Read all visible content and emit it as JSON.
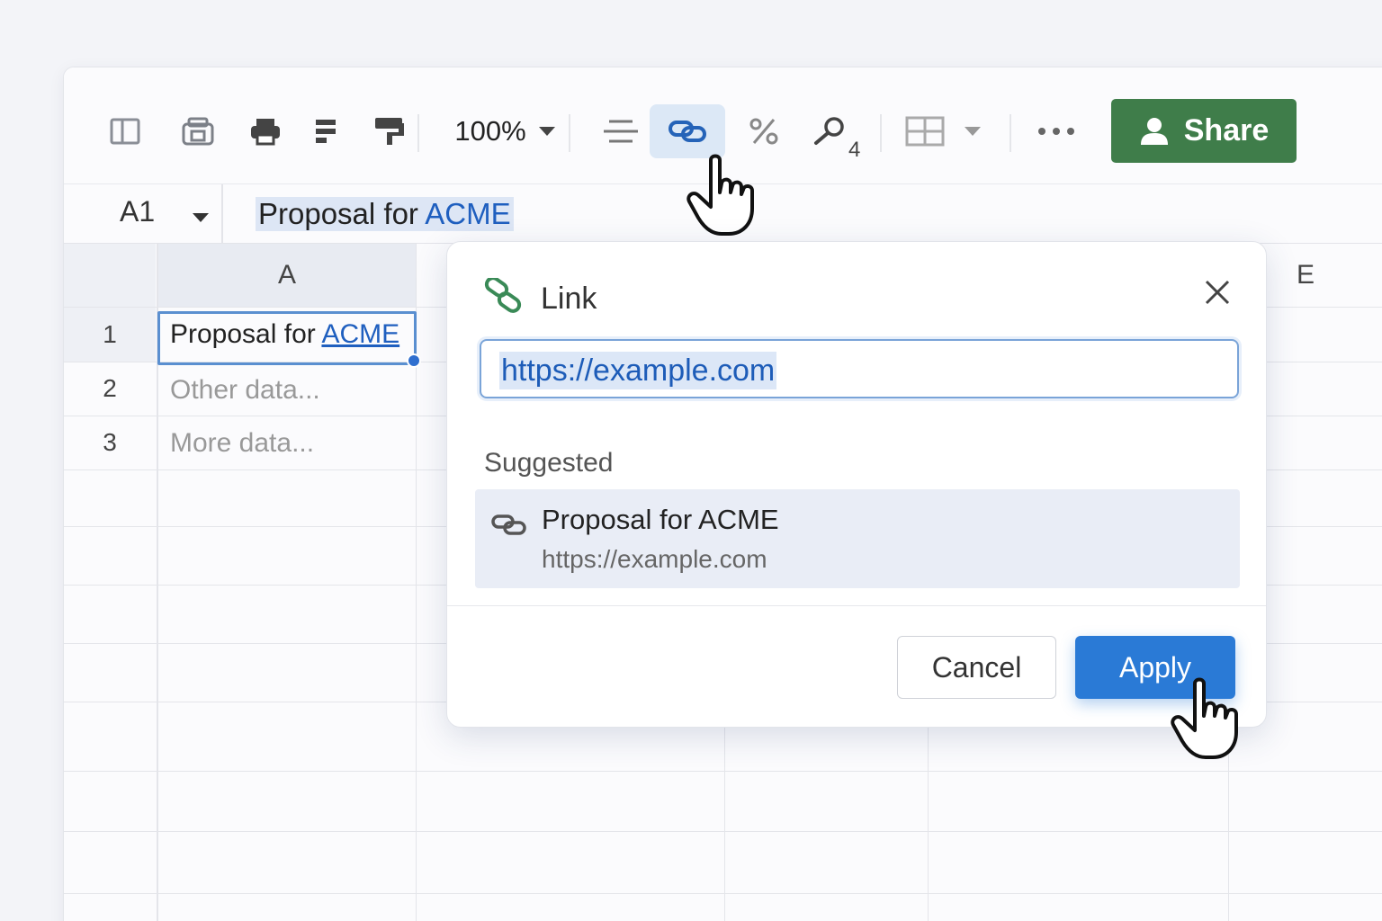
{
  "toolbar": {
    "zoom": "100%",
    "search_badge": "4",
    "share_label": "Share",
    "share_color": "#3f7d4a",
    "icons": [
      "sidebar-icon",
      "save-icon",
      "print-icon",
      "format-icon",
      "paint-format-icon",
      "align-icon",
      "link-icon",
      "percent-icon",
      "search-icon",
      "borders-icon",
      "more-icon"
    ]
  },
  "formula_bar": {
    "cell_ref": "A1",
    "text_prefix": "Proposal for ",
    "text_link": "ACME"
  },
  "grid": {
    "columns": [
      "A",
      "E"
    ],
    "rows": [
      {
        "num": "1",
        "text": "Proposal for ",
        "link": "ACME"
      },
      {
        "num": "2",
        "text": "Other data..."
      },
      {
        "num": "3",
        "text": "More data..."
      }
    ]
  },
  "link_dialog": {
    "title": "Link",
    "url_value": "https://example.com",
    "suggested_label": "Suggested",
    "suggestion": {
      "title": "Proposal for ACME",
      "url": "https://example.com"
    },
    "cancel_label": "Cancel",
    "apply_label": "Apply",
    "apply_color": "#2a7ad6"
  }
}
